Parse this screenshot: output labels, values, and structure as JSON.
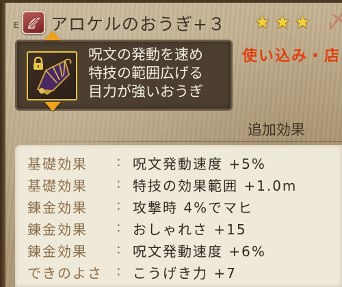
{
  "header": {
    "equip_mark": "E",
    "title": "アロケルのおうぎ+３",
    "stars": [
      "★",
      "★",
      "★"
    ],
    "stamp": "〆"
  },
  "item": {
    "icon": "fan-icon",
    "locked": true,
    "description": [
      "呪文の発動を速め",
      "特技の範囲広げる",
      "目力が強いおうぎ"
    ]
  },
  "usage_tab": "使い込み・店",
  "additional_effects": {
    "title": "追加効果",
    "rows": [
      {
        "label": "基礎効果",
        "value": "呪文発動速度 +5%"
      },
      {
        "label": "基礎効果",
        "value": "特技の効果範囲 +1.0m"
      },
      {
        "label": "錬金効果",
        "value": "攻撃時 4%でマヒ"
      },
      {
        "label": "錬金効果",
        "value": "おしゃれさ +15"
      },
      {
        "label": "錬金効果",
        "value": "呪文発動速度 +6%"
      },
      {
        "label": "できのよさ",
        "value": "こうげき力 +7"
      }
    ],
    "colon": ":"
  },
  "colors": {
    "star": "#f3d23a",
    "usage_tab": "#e04010",
    "panel": "#4c3f30",
    "effects_bg": "#efe9d9",
    "effects_label": "#8a6f4c"
  }
}
